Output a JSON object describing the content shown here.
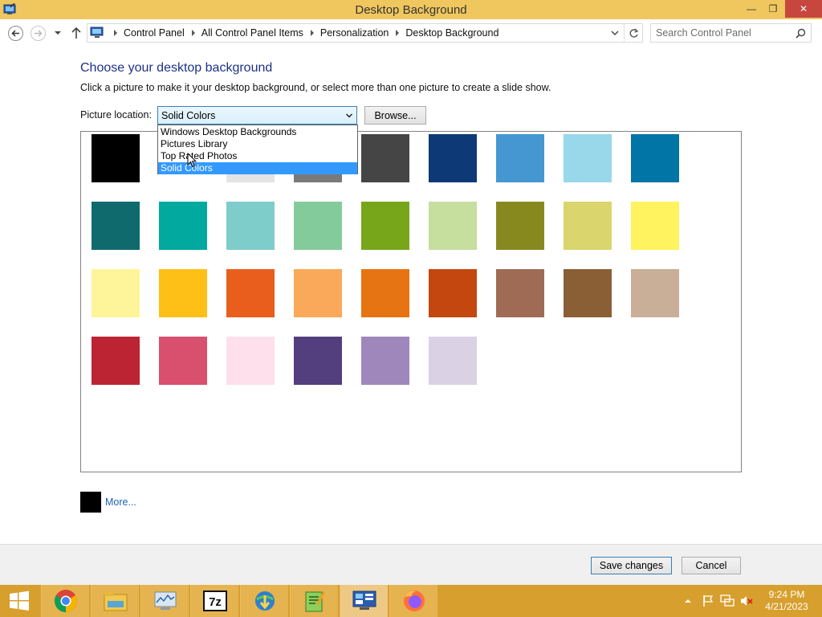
{
  "window": {
    "title": "Desktop Background",
    "controls": {
      "minimize": "—",
      "maximize": "❐",
      "close": "✕"
    }
  },
  "address_bar": {
    "breadcrumbs": [
      "Control Panel",
      "All Control Panel Items",
      "Personalization",
      "Desktop Background"
    ],
    "search_placeholder": "Search Control Panel"
  },
  "content": {
    "heading": "Choose your desktop background",
    "description": "Click a picture to make it your desktop background, or select more than one picture to create a slide show.",
    "picture_location_label": "Picture location:",
    "picture_location_value": "Solid Colors",
    "browse_label": "Browse...",
    "dropdown_options": [
      "Windows Desktop Backgrounds",
      "Pictures Library",
      "Top Rated Photos",
      "Solid Colors"
    ],
    "dropdown_selected_index": 3,
    "swatch_colors": [
      [
        "#000000",
        "#ffffff",
        "#e4e4e4",
        "#7a7a7a",
        "#454545",
        "#0d3a76",
        "#4597d2",
        "#99d7ea",
        "#0075a6"
      ],
      [
        "#0f6a6e",
        "#01a99e",
        "#7ecdcb",
        "#84cb9c",
        "#77a61a",
        "#c6de9e",
        "#87891e",
        "#dad56c",
        "#fff35f"
      ],
      [
        "#fef59a",
        "#fec016",
        "#e95e1d",
        "#faa95a",
        "#e67413",
        "#c3470f",
        "#a06b55",
        "#8a5f35",
        "#c9ae98"
      ],
      [
        "#bd2433",
        "#d94f6e",
        "#fde0ec",
        "#533e7e",
        "#9f87bb",
        "#dbd1e5"
      ]
    ],
    "more_label": "More...",
    "more_color": "#000000"
  },
  "footer": {
    "save_label": "Save changes",
    "cancel_label": "Cancel"
  },
  "taskbar": {
    "apps": [
      "chrome-icon",
      "file-explorer-icon",
      "system-monitor-icon",
      "7zip-icon",
      "internet-download-manager-icon",
      "notepad-plus-plus-icon",
      "control-panel-icon",
      "firefox-icon"
    ],
    "time": "9:24 PM",
    "date": "4/21/2023"
  },
  "colors": {
    "titlebar": "#f0c75e",
    "taskbar": "#d79f2d",
    "heading": "#1e3287",
    "link": "#1f5fb8",
    "selection": "#3399ff"
  }
}
